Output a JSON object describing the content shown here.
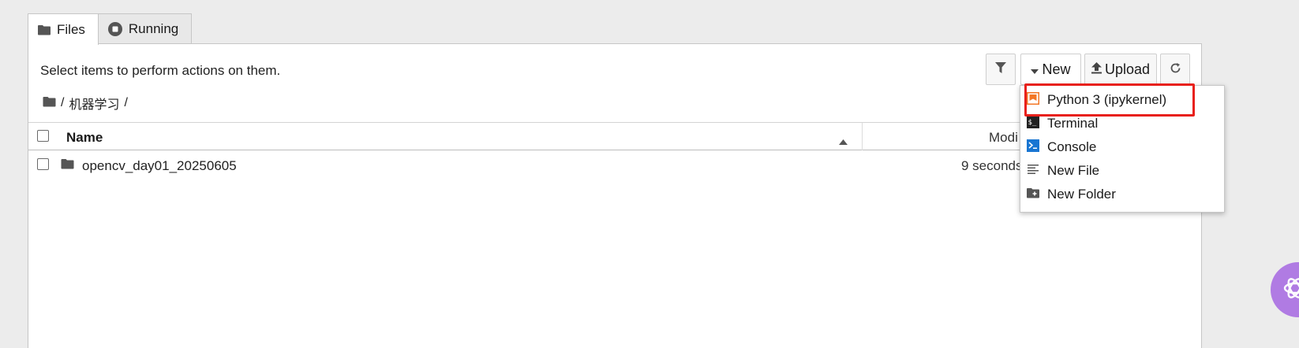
{
  "tabs": [
    {
      "label": "Files",
      "icon": "folder-icon"
    },
    {
      "label": "Running",
      "icon": "stop-circle-icon"
    }
  ],
  "toolbar": {
    "hint": "Select items to perform actions on them.",
    "new_label": "New",
    "upload_label": "Upload"
  },
  "breadcrumb": {
    "separator": "/",
    "folder": "机器学习",
    "trailing": "/"
  },
  "table": {
    "columns": {
      "name": "Name",
      "modified": "Modi"
    },
    "rows": [
      {
        "name": "opencv_day01_20250605",
        "modified": "9 seconds"
      }
    ]
  },
  "new_menu": {
    "items": [
      {
        "label": "Python 3 (ipykernel)",
        "icon": "notebook-icon"
      },
      {
        "label": "Terminal",
        "icon": "terminal-icon"
      },
      {
        "label": "Console",
        "icon": "console-icon"
      },
      {
        "label": "New File",
        "icon": "text-file-icon"
      },
      {
        "label": "New Folder",
        "icon": "new-folder-icon"
      }
    ]
  },
  "colors": {
    "highlight": "#e8201a",
    "fab": "#b07be3",
    "notebook_icon": "#f37726",
    "console_icon": "#1976d2"
  }
}
